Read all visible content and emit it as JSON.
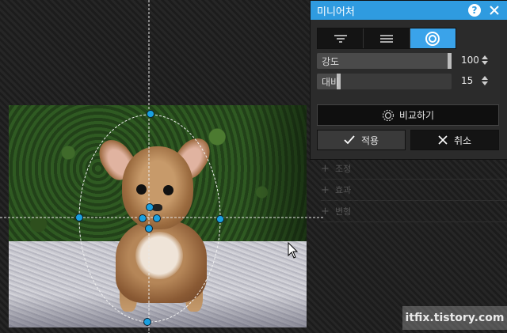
{
  "panel": {
    "title": "미니어처",
    "help_label": "?",
    "tabs": [
      {
        "icon": "filter-lines-icon",
        "active": false
      },
      {
        "icon": "menu-lines-icon",
        "active": false
      },
      {
        "icon": "concentric-circles-icon",
        "active": true
      }
    ],
    "sliders": [
      {
        "label": "강도",
        "value": "100",
        "fraction": 1.0
      },
      {
        "label": "대비",
        "value": "15",
        "fraction": 0.15
      }
    ],
    "compare_label": "비교하기",
    "apply_label": "적용",
    "cancel_label": "취소",
    "accent": "#2f9be0"
  },
  "sections": [
    {
      "label": "조정"
    },
    {
      "label": "효과"
    },
    {
      "label": "변형"
    }
  ],
  "watermark": "itfix.tistory.com"
}
